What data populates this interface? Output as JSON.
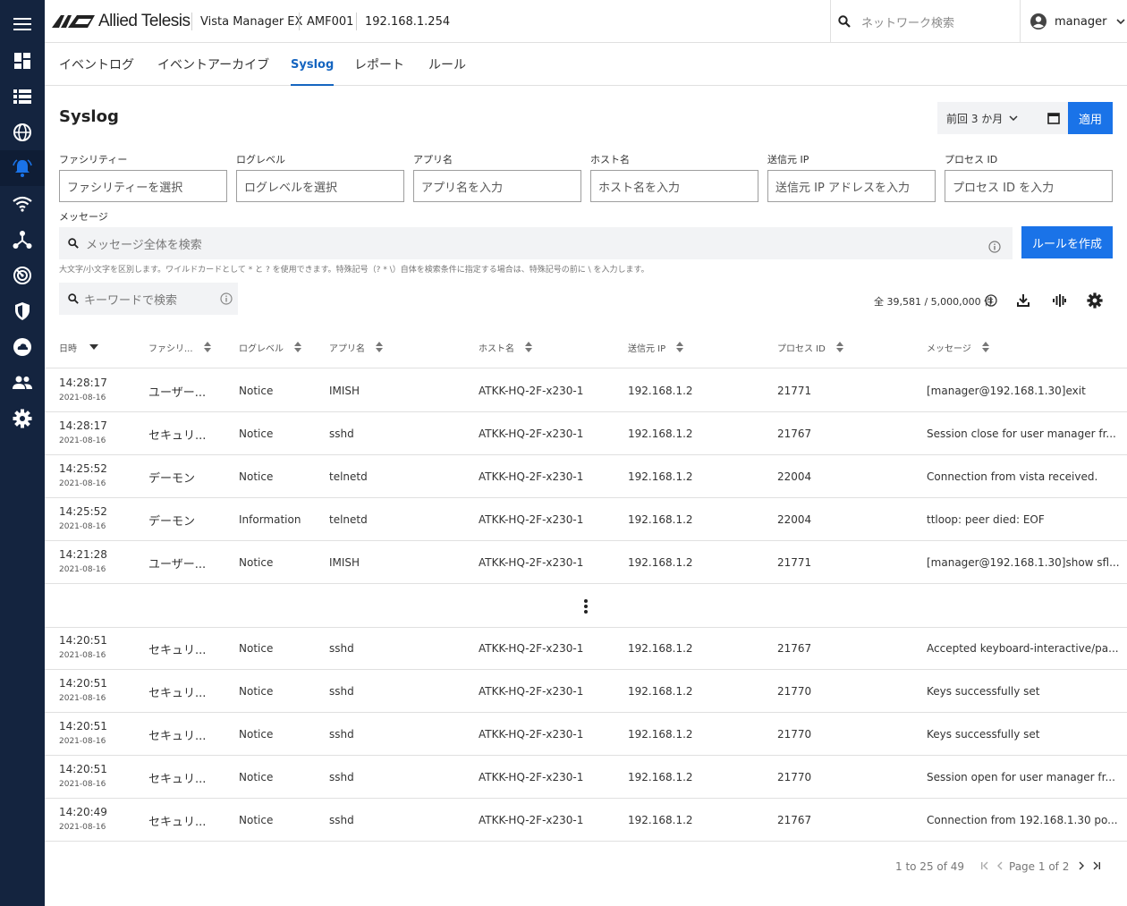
{
  "app": {
    "brand": "Allied Telesis",
    "product": "Vista Manager EX",
    "device": "AMF001",
    "ip": "192.168.1.254",
    "network_search_placeholder": "ネットワーク検索",
    "user": "manager"
  },
  "sidebar": {
    "items": [
      {
        "icon": "menu-icon"
      },
      {
        "icon": "dashboard-icon"
      },
      {
        "icon": "list-icon"
      },
      {
        "icon": "globe-icon"
      },
      {
        "icon": "bell-icon",
        "active": true
      },
      {
        "icon": "wifi-icon"
      },
      {
        "icon": "topology-icon"
      },
      {
        "icon": "radar-icon"
      },
      {
        "icon": "shield-icon"
      },
      {
        "icon": "cloud-icon"
      },
      {
        "icon": "users-icon"
      },
      {
        "icon": "gear-icon"
      }
    ]
  },
  "tabs": [
    {
      "label": "イベントログ"
    },
    {
      "label": "イベントアーカイブ"
    },
    {
      "label": "Syslog",
      "active": true
    },
    {
      "label": "レポート"
    },
    {
      "label": "ルール"
    }
  ],
  "page": {
    "title": "Syslog",
    "date_range": "前回 3 か月",
    "apply_label": "適用"
  },
  "filters": {
    "facility": {
      "label": "ファシリティー",
      "placeholder": "ファシリティーを選択"
    },
    "loglevel": {
      "label": "ログレベル",
      "placeholder": "ログレベルを選択"
    },
    "app": {
      "label": "アプリ名",
      "placeholder": "アプリ名を入力"
    },
    "host": {
      "label": "ホスト名",
      "placeholder": "ホスト名を入力"
    },
    "srcip": {
      "label": "送信元 IP",
      "placeholder": "送信元 IP アドレスを入力"
    },
    "pid": {
      "label": "プロセス ID",
      "placeholder": "プロセス ID を入力"
    },
    "message": {
      "label": "メッセージ",
      "placeholder": "メッセージ全体を検索"
    },
    "create_rule": "ルールを作成",
    "hint": "大文字/小文字を区別します。ワイルドカードとして * と ? を使用できます。特殊記号（? * \\）自体を検索条件に指定する場合は、特殊記号の前に \\ を入力します。",
    "keyword_placeholder": "キーワードで検索"
  },
  "count": "全 39,581 / 5,000,000 件",
  "table": {
    "headers": [
      "日時",
      "ファシリ...",
      "ログレベル",
      "アプリ名",
      "ホスト名",
      "送信元 IP",
      "プロセス ID",
      "メッセージ"
    ],
    "rows_top": [
      {
        "time": "14:28:17",
        "date": "2021-08-16",
        "facility": "ユーザー...",
        "level": "Notice",
        "app": "IMISH",
        "host": "ATKK-HQ-2F-x230-1",
        "ip": "192.168.1.2",
        "pid": "21771",
        "msg": "[manager@192.168.1.30]exit"
      },
      {
        "time": "14:28:17",
        "date": "2021-08-16",
        "facility": "セキュリ...",
        "level": "Notice",
        "app": "sshd",
        "host": "ATKK-HQ-2F-x230-1",
        "ip": "192.168.1.2",
        "pid": "21767",
        "msg": "Session close for user manager fr..."
      },
      {
        "time": "14:25:52",
        "date": "2021-08-16",
        "facility": "デーモン",
        "level": "Notice",
        "app": "telnetd",
        "host": "ATKK-HQ-2F-x230-1",
        "ip": "192.168.1.2",
        "pid": "22004",
        "msg": "Connection from vista received."
      },
      {
        "time": "14:25:52",
        "date": "2021-08-16",
        "facility": "デーモン",
        "level": "Information",
        "app": "telnetd",
        "host": "ATKK-HQ-2F-x230-1",
        "ip": "192.168.1.2",
        "pid": "22004",
        "msg": "ttloop: peer died: EOF"
      },
      {
        "time": "14:21:28",
        "date": "2021-08-16",
        "facility": "ユーザー...",
        "level": "Notice",
        "app": "IMISH",
        "host": "ATKK-HQ-2F-x230-1",
        "ip": "192.168.1.2",
        "pid": "21771",
        "msg": "[manager@192.168.1.30]show sfl..."
      }
    ],
    "rows_bottom": [
      {
        "time": "14:20:51",
        "date": "2021-08-16",
        "facility": "セキュリ...",
        "level": "Notice",
        "app": "sshd",
        "host": "ATKK-HQ-2F-x230-1",
        "ip": "192.168.1.2",
        "pid": "21767",
        "msg": "Accepted keyboard-interactive/pa..."
      },
      {
        "time": "14:20:51",
        "date": "2021-08-16",
        "facility": "セキュリ...",
        "level": "Notice",
        "app": "sshd",
        "host": "ATKK-HQ-2F-x230-1",
        "ip": "192.168.1.2",
        "pid": "21770",
        "msg": "Keys successfully set"
      },
      {
        "time": "14:20:51",
        "date": "2021-08-16",
        "facility": "セキュリ...",
        "level": "Notice",
        "app": "sshd",
        "host": "ATKK-HQ-2F-x230-1",
        "ip": "192.168.1.2",
        "pid": "21770",
        "msg": "Keys successfully set"
      },
      {
        "time": "14:20:51",
        "date": "2021-08-16",
        "facility": "セキュリ...",
        "level": "Notice",
        "app": "sshd",
        "host": "ATKK-HQ-2F-x230-1",
        "ip": "192.168.1.2",
        "pid": "21770",
        "msg": "Session open for user manager fr..."
      },
      {
        "time": "14:20:49",
        "date": "2021-08-16",
        "facility": "セキュリ...",
        "level": "Notice",
        "app": "sshd",
        "host": "ATKK-HQ-2F-x230-1",
        "ip": "192.168.1.2",
        "pid": "21767",
        "msg": "Connection from 192.168.1.30 po..."
      }
    ]
  },
  "pagination": {
    "range": "1 to 25 of 49",
    "page": "Page 1 of 2"
  },
  "colors": {
    "sidebar": "#14243f",
    "accent": "#1a73e8",
    "tab_active": "#1565c0"
  }
}
